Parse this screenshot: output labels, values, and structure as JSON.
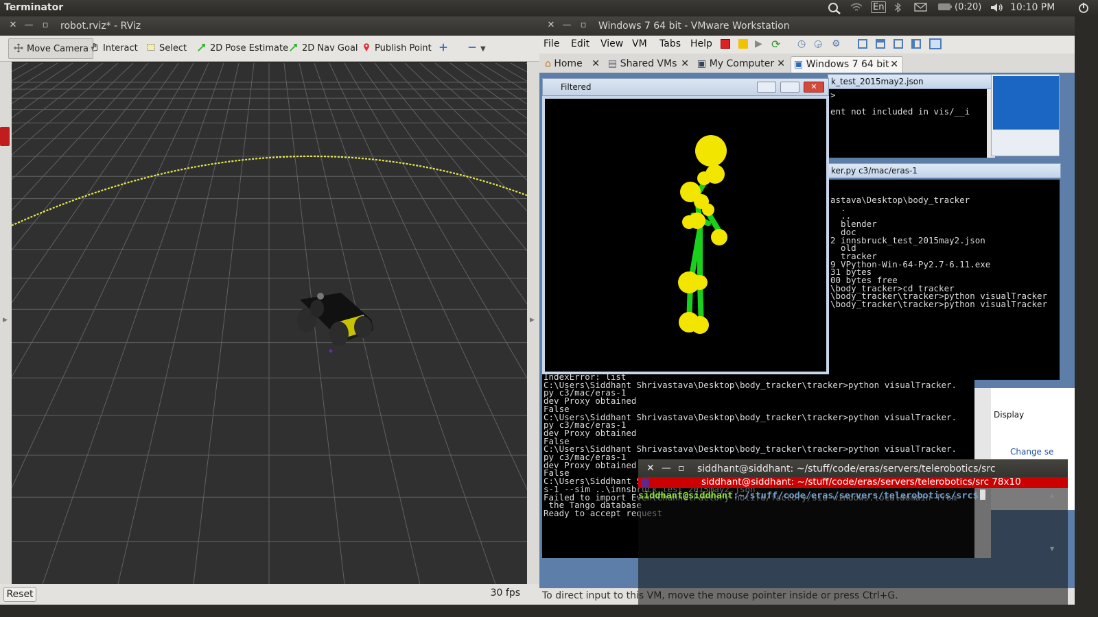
{
  "top_panel": {
    "app_name": "Terminator",
    "keyboard": "En",
    "battery": "(0:20)",
    "time": "10:10 PM"
  },
  "rviz": {
    "title": "robot.rviz* - RViz",
    "tools": [
      "Move Camera",
      "Interact",
      "Select",
      "2D Pose Estimate",
      "2D Nav Goal",
      "Publish Point"
    ],
    "reset_label": "Reset",
    "fps": "30 fps"
  },
  "vmware": {
    "title": "Windows 7 64 bit - VMware Workstation",
    "menu": [
      "File",
      "Edit",
      "View",
      "VM",
      "Tabs",
      "Help"
    ],
    "tabs": [
      "Home",
      "Shared VMs",
      "My Computer",
      "Windows 7 64 bit"
    ],
    "status": "To direct input to this VM, move the mouse pointer inside or press Ctrl+G.",
    "filtered_title": "Filtered",
    "json_window_title": "k_test_2015may2.json",
    "json_window_lines": [
      ">",
      "",
      "ent not included in vis/__i"
    ],
    "cmd2_title": "ker.py c3/mac/eras-1",
    "cmd2_lines": [
      "astava\\Desktop\\body_tracker",
      "",
      "  .",
      "  ..",
      "  blender",
      "  doc",
      "2 innsbruck_test_2015may2.json",
      "  old",
      "  tracker",
      "9 VPython-Win-64-Py2.7-6.11.exe",
      "31 bytes",
      "00 bytes free",
      "",
      "\\body_tracker>cd tracker",
      "",
      "\\body_tracker\\tracker>python visualTracker",
      "",
      "",
      "\\body_tracker\\tracker>python visualTracker"
    ],
    "cmd_main_lines": [
      "IndexError: list",
      "",
      "C:\\Users\\Siddhant Shrivastava\\Desktop\\body_tracker\\tracker>python visualTracker.",
      "py c3/mac/eras-1",
      "dev Proxy obtained",
      "False",
      "",
      "C:\\Users\\Siddhant Shrivastava\\Desktop\\body_tracker\\tracker>python visualTracker.",
      "py c3/mac/eras-1",
      "dev Proxy obtained",
      "False",
      "",
      "C:\\Users\\Siddhant Shrivastava\\Desktop\\body_tracker\\tracker>python visualTracker.",
      "py c3/mac/eras-1",
      "dev Proxy obtained",
      "False",
      "",
      "C:\\Users\\Siddhant Shrivastava\\Desktop\\body_tracker\\tracker>python tracker.py era",
      "s-1 --sim ..\\innsbruck_test_2015may2.json",
      "Failed to import EventChannelFactory notifd/factory/sid-windows.localdomain from",
      " the Tango database",
      "Ready to accept request"
    ],
    "control_panel_label": "Display",
    "change_label": "Change se"
  },
  "terminal": {
    "title": "siddhant@siddhant: ~/stuff/code/eras/servers/telerobotics/src",
    "tab_label": "siddhant@siddhant: ~/stuff/code/eras/servers/telerobotics/src 78x10",
    "prompt_user": "siddhant@siddhant",
    "prompt_path": ":~/stuff/code/eras/servers/telerobotics/src$"
  },
  "colors": {
    "terminal_tab_red": "#cc0000",
    "prompt_green": "#8ae234",
    "prompt_blue": "#729fcf",
    "skeleton_green": "#19d11c",
    "joint_yellow": "#f2e600"
  }
}
